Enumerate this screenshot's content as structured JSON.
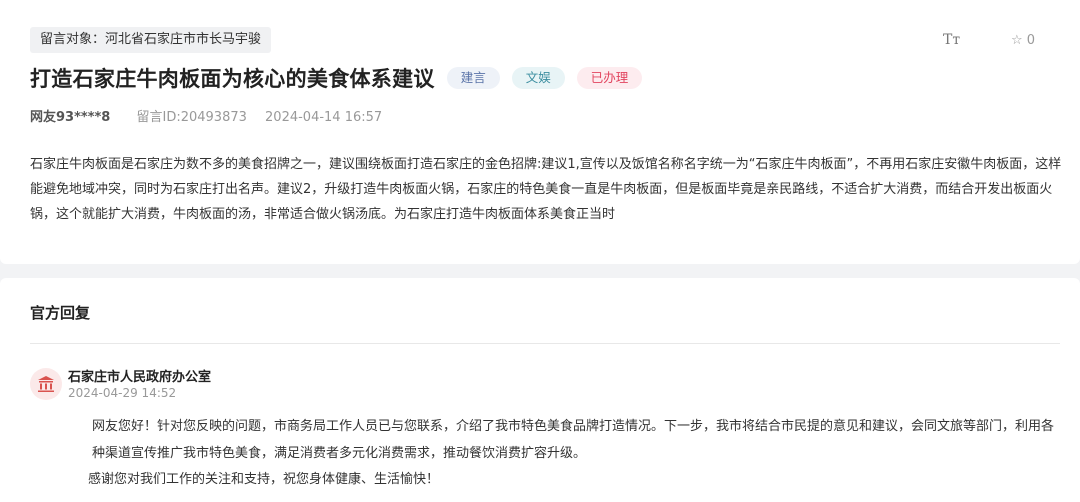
{
  "message": {
    "target": "留言对象：河北省石家庄市市长马宇骏",
    "font_size_icon": "Tт",
    "favorite_icon": "☆",
    "favorite_count": "0",
    "title": "打造石家庄牛肉板面为核心的美食体系建议",
    "tags": [
      "建言",
      "文娱",
      "已办理"
    ],
    "user": "网友93****8",
    "message_id": "留言ID:20493873",
    "time": "2024-04-14 16:57",
    "content": "石家庄牛肉板面是石家庄为数不多的美食招牌之一，建议围绕板面打造石家庄的金色招牌:建议1,宣传以及饭馆名称名字统一为“石家庄牛肉板面”，不再用石家庄安徽牛肉板面，这样能避免地域冲突，同时为石家庄打出名声。建议2，升级打造牛肉板面火锅，石家庄的特色美食一直是牛肉板面，但是板面毕竟是亲民路线，不适合扩大消费，而结合开发出板面火锅，这个就能扩大消费，牛肉板面的汤，非常适合做火锅汤底。为石家庄打造牛肉板面体系美食正当时"
  },
  "reply": {
    "section_title": "官方回复",
    "department_icon": "government-building-icon",
    "department": "石家庄市人民政府办公室",
    "time": "2024-04-29 14:52",
    "paragraphs": [
      "网友您好！针对您反映的问题，市商务局工作人员已与您联系，介绍了我市特色美食品牌打造情况。下一步，我市将结合市民提的意见和建议，会同文旅等部门，利用各种渠道宣传推广我市特色美食，满足消费者多元化消费需求，推动餐饮消费扩容升级。",
      "感谢您对我们工作的关注和支持，祝您身体健康、生活愉快！"
    ]
  },
  "colors": {
    "tag_suggestion": "#5a74a8",
    "tag_culture": "#3c8ea0",
    "tag_done": "#e2455f",
    "avatar_bg": "#fbe9e9",
    "avatar_icon": "#d9534f"
  }
}
